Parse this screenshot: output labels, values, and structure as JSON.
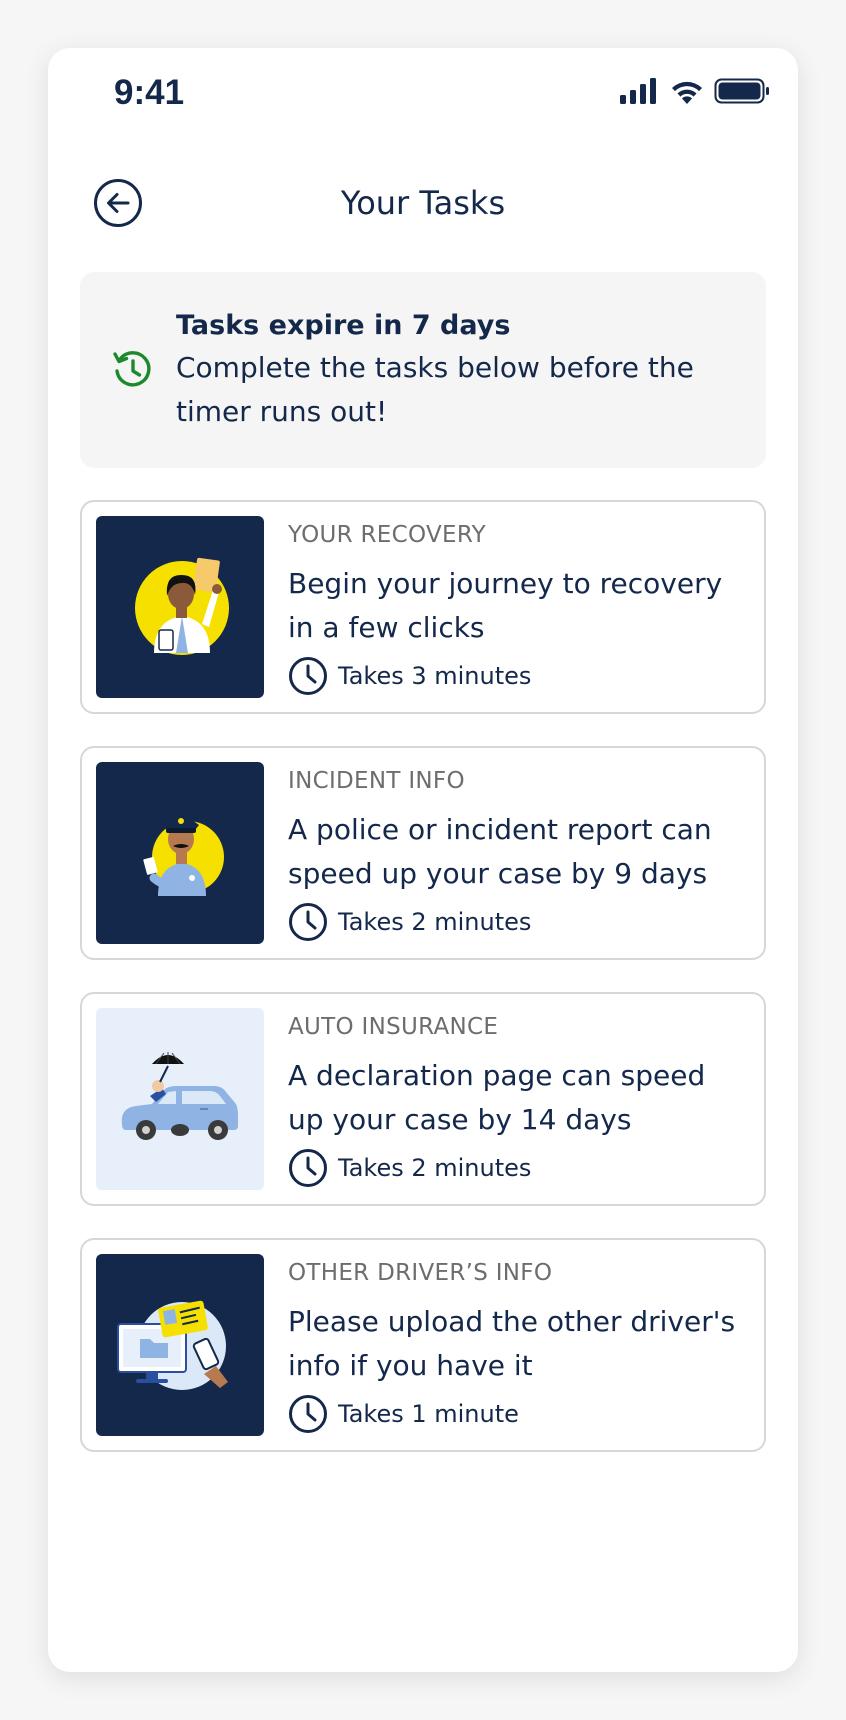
{
  "status_bar": {
    "time": "9:41",
    "icons": [
      "signal-icon",
      "wifi-icon",
      "battery-icon"
    ]
  },
  "header": {
    "title": "Your Tasks",
    "back_icon": "back-arrow-icon"
  },
  "banner": {
    "icon": "timer-history-icon",
    "title": "Tasks expire in 7 days",
    "body": "Complete the tasks below before the timer runs out!"
  },
  "tasks": [
    {
      "category": "YOUR RECOVERY",
      "title": "Begin your journey to recovery in a few clicks",
      "duration": "Takes 3 minutes",
      "illustration": "doctor-illustration",
      "thumb_style": "dark"
    },
    {
      "category": "INCIDENT INFO",
      "title": "A police or incident report can speed up your case by 9 days",
      "duration": "Takes 2 minutes",
      "illustration": "police-officer-illustration",
      "thumb_style": "light-dark"
    },
    {
      "category": "AUTO INSURANCE",
      "title": "A declaration page can speed up your case by 14 days",
      "duration": "Takes 2 minutes",
      "illustration": "car-umbrella-illustration",
      "thumb_style": "light"
    },
    {
      "category": "OTHER DRIVER’S INFO",
      "title": "Please upload the other driver's info if you have it",
      "duration": "Takes 1 minute",
      "illustration": "driver-license-upload-illustration",
      "thumb_style": "dark"
    }
  ],
  "colors": {
    "navy": "#14284b",
    "accent_green": "#1a8a2a",
    "yellow": "#f6e000",
    "light_blue": "#8fb4e3",
    "page_bg": "#f6f6f6",
    "banner_bg": "#f5f5f5",
    "card_border": "#d7d7d7",
    "category_gray": "#6d6d6d"
  }
}
